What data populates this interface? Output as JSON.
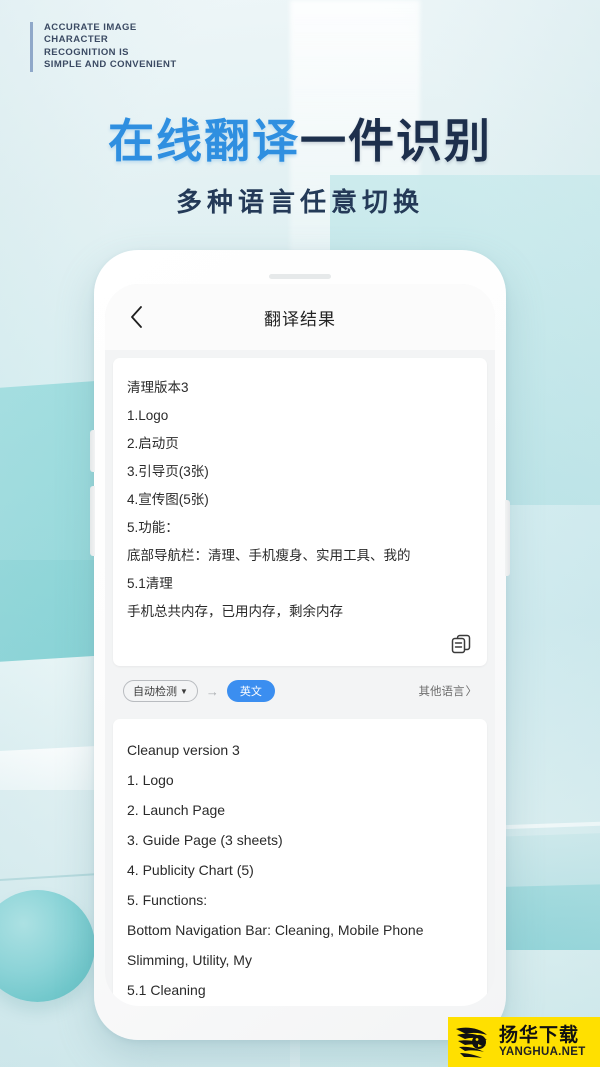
{
  "promo": {
    "kicker_lines": [
      "ACCURATE IMAGE",
      "CHARACTER",
      "RECOGNITION IS",
      "SIMPLE AND CONVENIENT"
    ],
    "title_blue": "在线翻译",
    "title_dark": "一件识别",
    "subtitle": "多种语言任意切换",
    "colors": {
      "blue": "#2f8fe0",
      "dark": "#1d2f4c",
      "accent_bar": "#8fa8c9"
    }
  },
  "phone": {
    "nav": {
      "back_icon": "chevron-left-icon",
      "title": "翻译结果"
    },
    "source_panel": {
      "lines": [
        "清理版本3",
        "1.Logo",
        "2.启动页",
        "3.引导页(3张)",
        "4.宣传图(5张)",
        "5.功能：",
        "底部导航栏：清理、手机瘦身、实用工具、我的",
        "5.1清理",
        "手机总共内存，已用内存，剩余内存"
      ],
      "copy_icon": "copy-icon"
    },
    "language_bar": {
      "source_label": "自动检测",
      "source_caret": "▼",
      "arrow": "→",
      "target_label": "英文",
      "other_label": "其他语言",
      "other_chevron": "〉",
      "target_color": "#3b8ef0"
    },
    "result_panel": {
      "lines": [
        "Cleanup version 3",
        "1. Logo",
        "2. Launch Page",
        "3. Guide Page (3 sheets)",
        "4. Publicity Chart (5)",
        "5. Functions:",
        "Bottom Navigation Bar: Cleaning, Mobile Phone",
        "Slimming, Utility, My",
        "5.1 Cleaning"
      ],
      "share_icon": "share-icon",
      "copy_icon": "copy-icon"
    }
  },
  "watermark": {
    "brand_cn": "扬华下载",
    "brand_en": "YANGHUA.NET",
    "bg_color": "#ffe000"
  }
}
